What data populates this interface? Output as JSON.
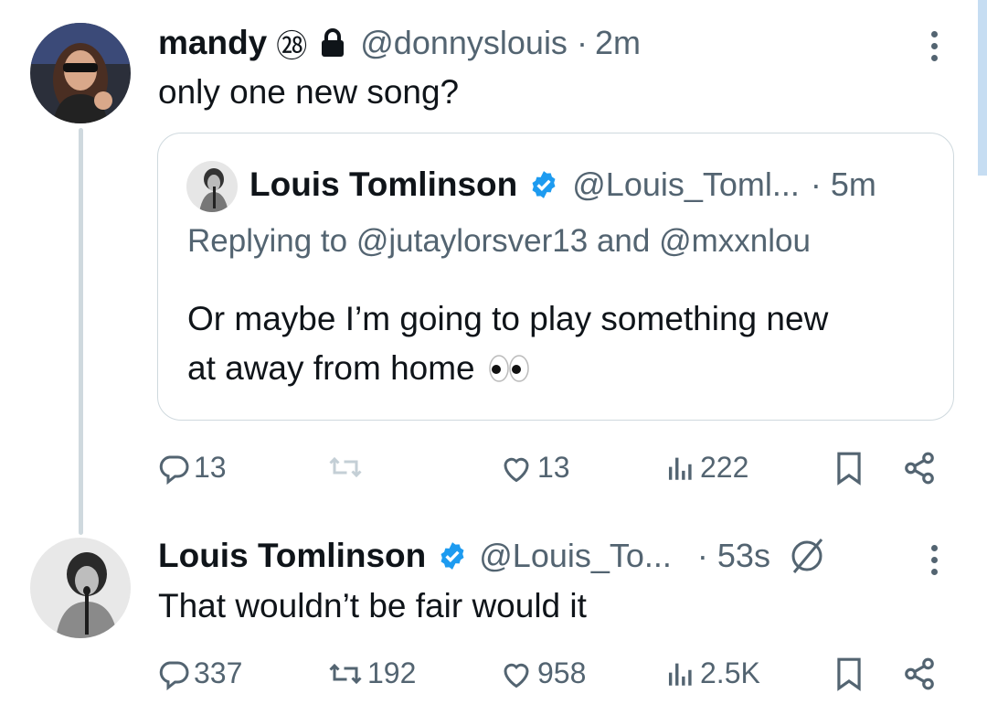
{
  "post1": {
    "display_name": "mandy",
    "badge": "㉘",
    "handle": "@donnyslouis",
    "time_sep": "·",
    "time": "2m",
    "text": "only one new song?",
    "more_icon": "more-vertical-icon"
  },
  "quote": {
    "display_name": "Louis Tomlinson",
    "handle": "@Louis_Toml...",
    "time": "· 5m",
    "replying_to": "Replying to @jutaylorsver13 and @mxxnlou",
    "text_line1": "Or maybe I’m going to play something new",
    "text_line2": "at away from home",
    "emoji": "eyes-icon"
  },
  "post1_actions": {
    "replies": "13",
    "reposts": "",
    "likes": "13",
    "views": "222"
  },
  "post2": {
    "display_name": "Louis Tomlinson",
    "handle": "@Louis_To...",
    "time": "· 53s",
    "text": "That wouldn’t be fair would it",
    "more_icon": "more-vertical-icon"
  },
  "post2_actions": {
    "replies": "337",
    "reposts": "192",
    "likes": "958",
    "views": "2.5K"
  },
  "colors": {
    "text": "#0f1419",
    "secondary": "#536471",
    "verified": "#1d9bf0",
    "border": "#cfd9de"
  }
}
